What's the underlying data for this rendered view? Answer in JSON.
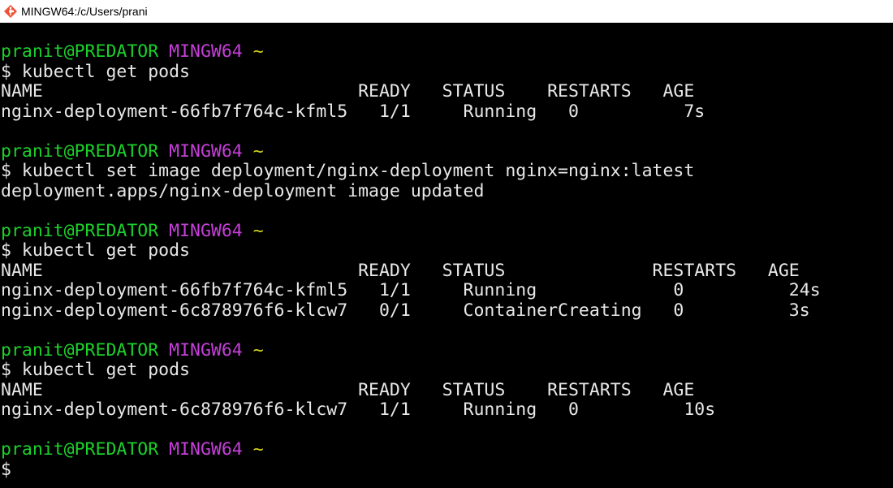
{
  "window": {
    "title": "MINGW64:/c/Users/prani",
    "icon": "git-bash-diamond-icon"
  },
  "colors": {
    "user": "#1bd12b",
    "host": "#c53fd8",
    "tilde": "#d2d21b",
    "text": "#e8e8e8",
    "background": "#000000"
  },
  "terminal": {
    "blocks": [
      {
        "prompt": {
          "user": "pranit@PREDATOR",
          "host": "MINGW64",
          "path": "~"
        },
        "command": "$ kubectl get pods",
        "output": [
          "NAME                              READY   STATUS    RESTARTS   AGE",
          "nginx-deployment-66fb7f764c-kfml5   1/1     Running   0          7s"
        ]
      },
      {
        "prompt": {
          "user": "pranit@PREDATOR",
          "host": "MINGW64",
          "path": "~"
        },
        "command": "$ kubectl set image deployment/nginx-deployment nginx=nginx:latest",
        "output": [
          "deployment.apps/nginx-deployment image updated"
        ]
      },
      {
        "prompt": {
          "user": "pranit@PREDATOR",
          "host": "MINGW64",
          "path": "~"
        },
        "command": "$ kubectl get pods",
        "output": [
          "NAME                              READY   STATUS              RESTARTS   AGE",
          "nginx-deployment-66fb7f764c-kfml5   1/1     Running             0          24s",
          "nginx-deployment-6c878976f6-klcw7   0/1     ContainerCreating   0          3s"
        ]
      },
      {
        "prompt": {
          "user": "pranit@PREDATOR",
          "host": "MINGW64",
          "path": "~"
        },
        "command": "$ kubectl get pods",
        "output": [
          "NAME                              READY   STATUS    RESTARTS   AGE",
          "nginx-deployment-6c878976f6-klcw7   1/1     Running   0          10s"
        ]
      },
      {
        "prompt": {
          "user": "pranit@PREDATOR",
          "host": "MINGW64",
          "path": "~"
        },
        "command": "$",
        "output": []
      }
    ]
  }
}
